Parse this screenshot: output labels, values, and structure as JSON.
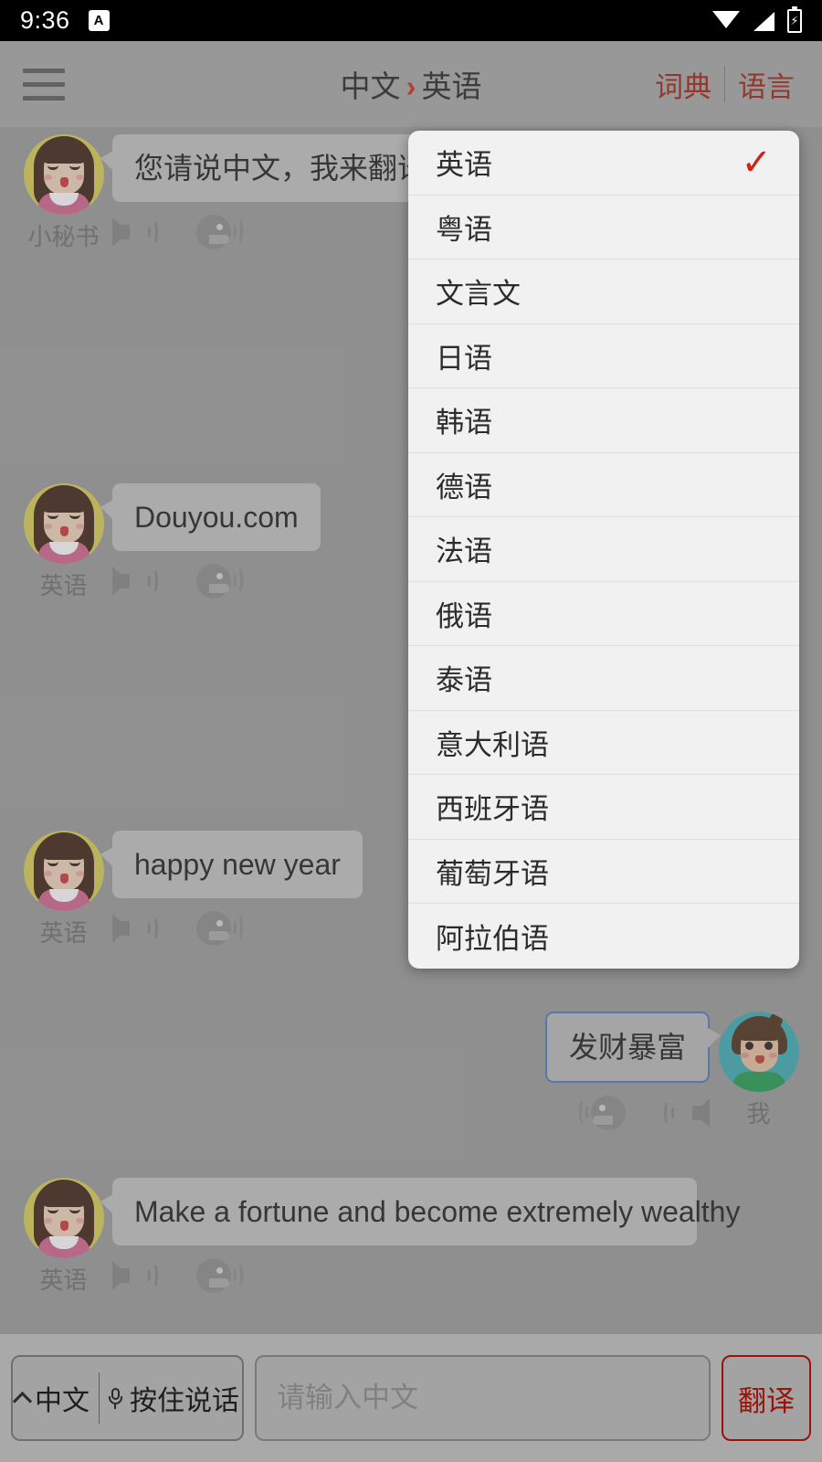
{
  "status_bar": {
    "time": "9:36",
    "notification_icon": "A",
    "icons": [
      "wifi-icon",
      "signal-icon",
      "battery-charging-icon"
    ]
  },
  "app_bar": {
    "menu_icon": "hamburger-icon",
    "title_source": "中文",
    "title_arrow": "›",
    "title_target": "英语",
    "action_dictionary": "词典",
    "action_language": "语言"
  },
  "messages": [
    {
      "side": "left",
      "avatar": "female",
      "name": "小秘书",
      "text": "您请说中文，我来翻译",
      "controls": [
        "speaker-icon",
        "talking-head-icon"
      ]
    },
    {
      "side": "left",
      "avatar": "female",
      "name": "英语",
      "text": "Douyou.com",
      "controls": [
        "speaker-icon",
        "talking-head-icon"
      ]
    },
    {
      "side": "left",
      "avatar": "female",
      "name": "英语",
      "text": "happy new year",
      "controls": [
        "speaker-icon",
        "talking-head-icon"
      ]
    },
    {
      "side": "right",
      "avatar": "male",
      "name": "我",
      "text": "发财暴富",
      "controls": [
        "talking-head-icon",
        "speaker-icon"
      ]
    },
    {
      "side": "left",
      "avatar": "female",
      "name": "英语",
      "text": "Make a fortune and become extremely wealthy",
      "controls": [
        "speaker-icon",
        "talking-head-icon"
      ]
    }
  ],
  "language_dropdown": {
    "selected": "英语",
    "check_glyph": "✓",
    "items": [
      "英语",
      "粤语",
      "文言文",
      "日语",
      "韩语",
      "德语",
      "法语",
      "俄语",
      "泰语",
      "意大利语",
      "西班牙语",
      "葡萄牙语",
      "阿拉伯语"
    ]
  },
  "bottom_bar": {
    "voice_lang": "中文",
    "voice_hold": "按住说话",
    "input_value": "",
    "input_placeholder": "请输入中文",
    "translate_label": "翻译"
  },
  "colors": {
    "accent_red": "#a01c10",
    "title_arrow_red": "#cc2a18",
    "check_red": "#c8261a",
    "bubble_gray": "#c2c2c2",
    "my_bubble_border": "#4a77c4",
    "dropdown_bg": "#f1f1f1",
    "appbar_bg": "#a7a7a7",
    "screen_bg": "#9a9a9a"
  }
}
